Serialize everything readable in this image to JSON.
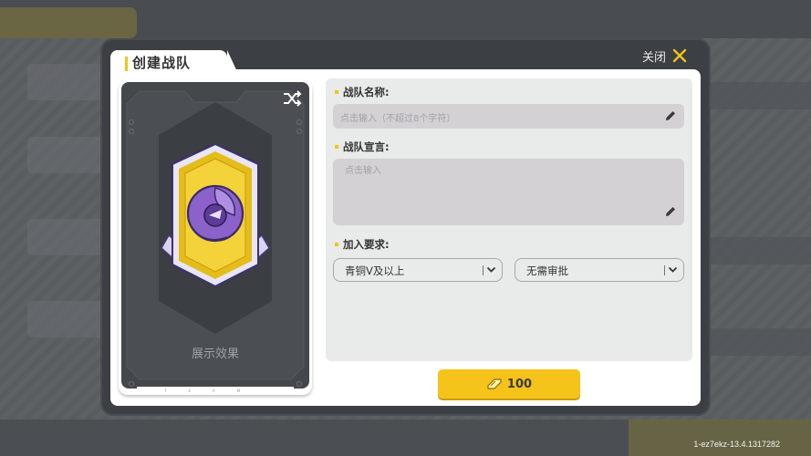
{
  "modal": {
    "title": "创建战队",
    "close_label": "关闭"
  },
  "preview": {
    "caption": "展示效果",
    "footer_text": "TEAM",
    "icons": [
      "shuffle-icon",
      "team-badge-emblem"
    ]
  },
  "form": {
    "name_label": "战队名称:",
    "name_placeholder": "点击输入（不超过8个字符）",
    "declaration_label": "战队宣言:",
    "declaration_placeholder": "点击输入",
    "requirement_label": "加入要求:",
    "rank_select_value": "青铜V及以上",
    "approval_select_value": "无需审批"
  },
  "create_button": {
    "cost": "100",
    "icon": "coin-icon"
  },
  "version": "1-ez7ekz-13.4.1317282",
  "colors": {
    "accent": "#f0c419",
    "button": "#f6c31a",
    "badge_purple": "#8b62c9",
    "frame": "#3c3f44"
  }
}
